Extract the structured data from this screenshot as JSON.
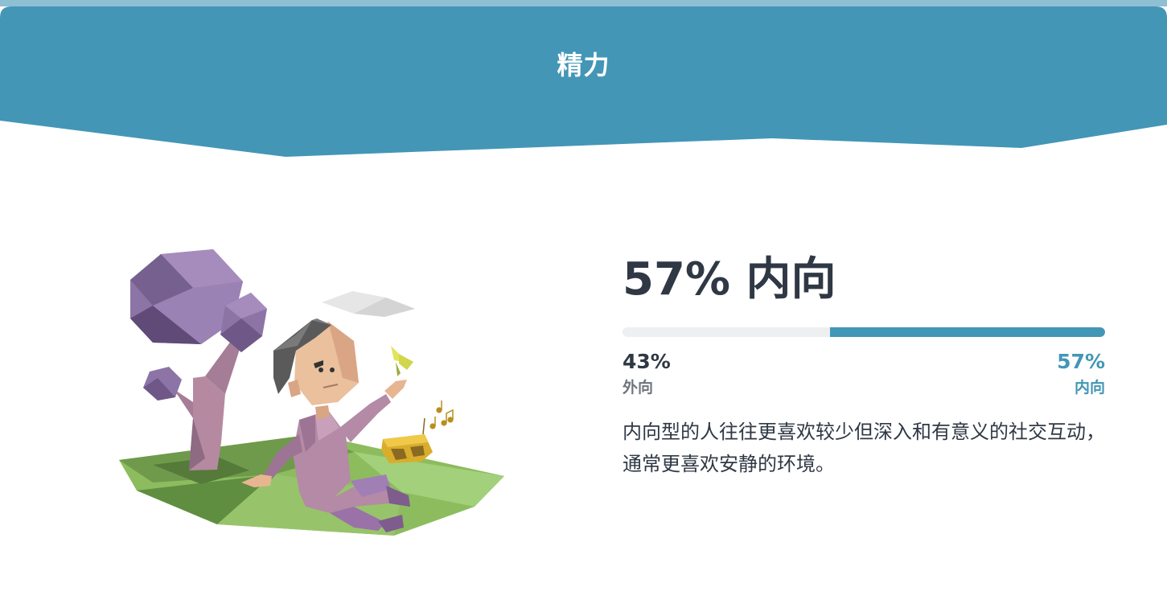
{
  "header": {
    "title": "精力",
    "color": "#4396b6"
  },
  "result": {
    "headline": "57% 内向",
    "introvert_fraction": 0.57,
    "left": {
      "percent": "43%",
      "label": "外向"
    },
    "right": {
      "percent": "57%",
      "label": "内向",
      "color": "#4297b6"
    },
    "description": "内向型的人往往更喜欢较少但深入和有意义的社交互动，通常更喜欢安静的环境。"
  },
  "illustration": {
    "icon": "introvert-person-illustration"
  }
}
